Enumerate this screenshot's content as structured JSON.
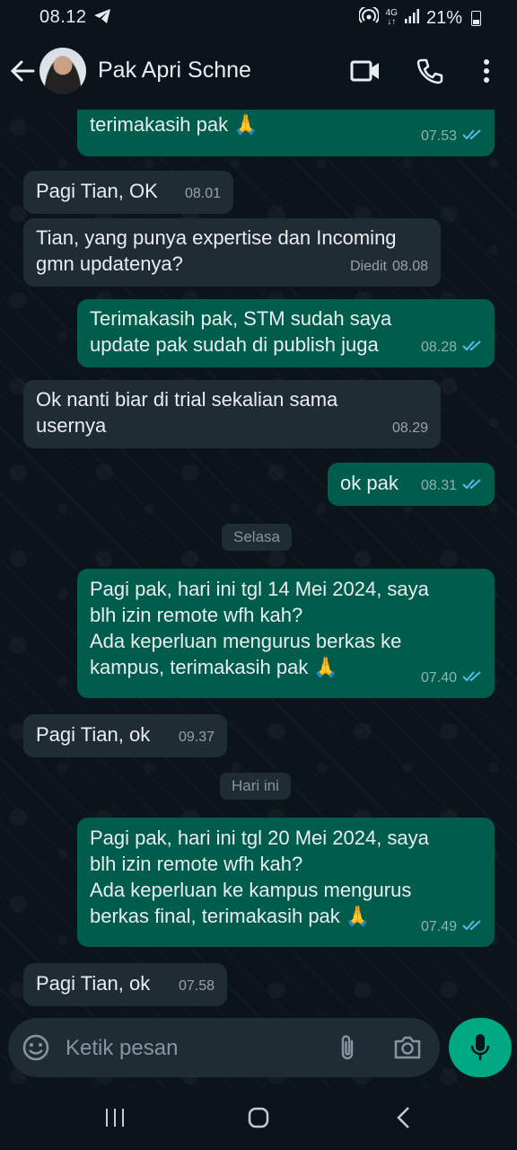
{
  "status_bar": {
    "time": "08.12",
    "network": "4G",
    "battery": "21%"
  },
  "header": {
    "contact_name": "Pak Apri Schne",
    "icons": [
      "back-arrow-icon",
      "video-call-icon",
      "voice-call-icon",
      "more-vert-icon"
    ]
  },
  "messages": [
    {
      "dir": "out",
      "text": "terimakasih pak 🙏",
      "time": "07.53",
      "read": true
    },
    {
      "dir": "in",
      "text": "Pagi Tian, OK",
      "time": "08.01"
    },
    {
      "dir": "in",
      "text": "Tian, yang punya expertise dan Incoming\ngmn updatenya?",
      "time": "08.08",
      "edited_label": "Diedit"
    },
    {
      "dir": "out",
      "text": "Terimakasih pak, STM sudah saya\nupdate pak sudah di publish juga",
      "time": "08.28",
      "read": true
    },
    {
      "dir": "in",
      "text": "Ok nanti biar di trial sekalian sama\nusernya",
      "time": "08.29"
    },
    {
      "dir": "out",
      "text": "ok pak",
      "time": "08.31",
      "read": true
    },
    {
      "dir": "out",
      "text": "Pagi pak, hari ini tgl 14 Mei 2024, saya\nblh izin remote wfh kah?\nAda keperluan mengurus berkas ke\nkampus,  terimakasih pak 🙏",
      "time": "07.40",
      "read": true
    },
    {
      "dir": "in",
      "text": "Pagi Tian, ok",
      "time": "09.37"
    },
    {
      "dir": "out",
      "text": "Pagi pak, hari ini tgl 20 Mei 2024, saya\nblh izin remote wfh kah?\nAda keperluan ke kampus mengurus\nberkas final,  terimakasih pak 🙏",
      "time": "07.49",
      "read": true
    },
    {
      "dir": "in",
      "text": "Pagi Tian, ok",
      "time": "07.58"
    }
  ],
  "date_separators": [
    "Selasa",
    "Hari ini"
  ],
  "composer": {
    "placeholder": "Ketik pesan",
    "icons": [
      "emoji-icon",
      "attach-icon",
      "camera-icon",
      "mic-icon"
    ]
  },
  "colors": {
    "background": "#0b141a",
    "bubble_in": "#202c33",
    "bubble_out": "#005c4b",
    "accent": "#00a884",
    "read_ticks": "#53bdeb"
  }
}
